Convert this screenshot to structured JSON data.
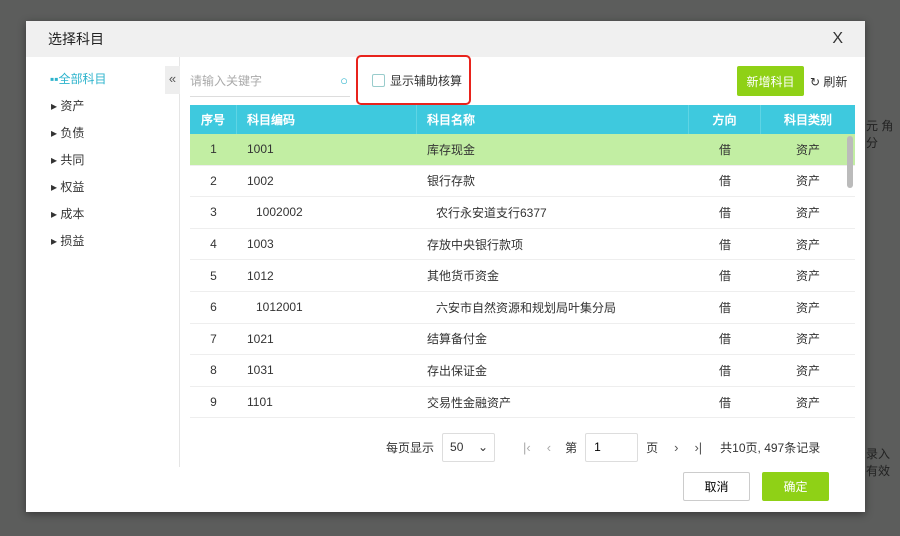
{
  "background": {
    "col_labels": "元 角 分",
    "hint": "录入有效"
  },
  "modal": {
    "title": "选择科目",
    "close": "X"
  },
  "sidebar": {
    "items": [
      {
        "label": "全部科目"
      },
      {
        "label": "资产"
      },
      {
        "label": "负债"
      },
      {
        "label": "共同"
      },
      {
        "label": "权益"
      },
      {
        "label": "成本"
      },
      {
        "label": "损益"
      }
    ]
  },
  "toolbar": {
    "search_placeholder": "请输入关键字",
    "show_aux_label": "显示辅助核算",
    "add_label": "新增科目",
    "refresh_label": "刷新"
  },
  "table": {
    "headers": [
      "序号",
      "科目编码",
      "科目名称",
      "方向",
      "科目类别"
    ],
    "rows": [
      [
        "1",
        "1001",
        "库存现金",
        "借",
        "资产"
      ],
      [
        "2",
        "1002",
        "银行存款",
        "借",
        "资产"
      ],
      [
        "3",
        "  1002002",
        "  农行永安道支行6377",
        "借",
        "资产"
      ],
      [
        "4",
        "1003",
        "存放中央银行款项",
        "借",
        "资产"
      ],
      [
        "5",
        "1012",
        "其他货币资金",
        "借",
        "资产"
      ],
      [
        "6",
        "  1012001",
        "  六安市自然资源和规划局叶集分局",
        "借",
        "资产"
      ],
      [
        "7",
        "1021",
        "结算备付金",
        "借",
        "资产"
      ],
      [
        "8",
        "1031",
        "存出保证金",
        "借",
        "资产"
      ],
      [
        "9",
        "1101",
        "交易性金融资产",
        "借",
        "资产"
      ]
    ],
    "selected_index": 0
  },
  "pager": {
    "per_page_label": "每页显示",
    "per_page": "50",
    "page_prefix": "第",
    "page": "1",
    "page_suffix": "页",
    "summary": "共10页, 497条记录"
  },
  "footer": {
    "cancel": "取消",
    "ok": "确定"
  },
  "colors": {
    "accent": "#3ec9de",
    "primary": "#8fd116",
    "highlight": "#e8231c",
    "selected_row": "#c2eea3"
  }
}
